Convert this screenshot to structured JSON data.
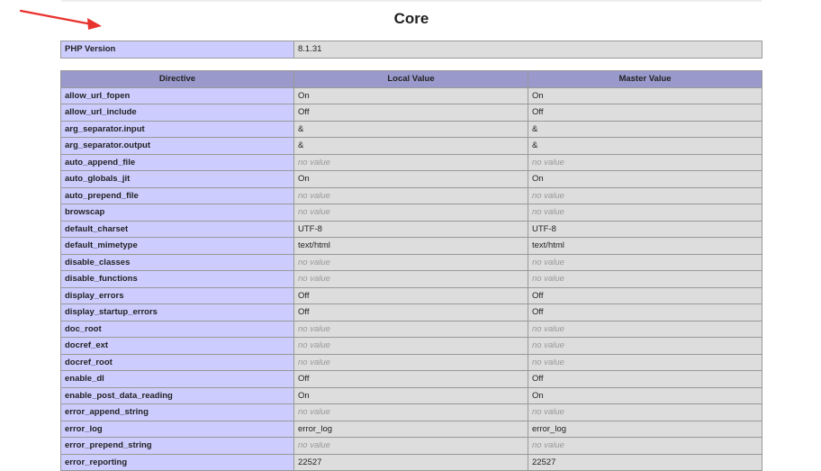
{
  "heading": "Core",
  "info_row": {
    "label": "PHP Version",
    "value": "8.1.31"
  },
  "headers": {
    "directive": "Directive",
    "local": "Local Value",
    "master": "Master Value"
  },
  "rows": [
    {
      "directive": "allow_url_fopen",
      "local": "On",
      "master": "On"
    },
    {
      "directive": "allow_url_include",
      "local": "Off",
      "master": "Off"
    },
    {
      "directive": "arg_separator.input",
      "local": "&",
      "master": "&"
    },
    {
      "directive": "arg_separator.output",
      "local": "&",
      "master": "&"
    },
    {
      "directive": "auto_append_file",
      "local": "no value",
      "master": "no value",
      "novalue": true
    },
    {
      "directive": "auto_globals_jit",
      "local": "On",
      "master": "On"
    },
    {
      "directive": "auto_prepend_file",
      "local": "no value",
      "master": "no value",
      "novalue": true
    },
    {
      "directive": "browscap",
      "local": "no value",
      "master": "no value",
      "novalue": true
    },
    {
      "directive": "default_charset",
      "local": "UTF-8",
      "master": "UTF-8"
    },
    {
      "directive": "default_mimetype",
      "local": "text/html",
      "master": "text/html"
    },
    {
      "directive": "disable_classes",
      "local": "no value",
      "master": "no value",
      "novalue": true
    },
    {
      "directive": "disable_functions",
      "local": "no value",
      "master": "no value",
      "novalue": true
    },
    {
      "directive": "display_errors",
      "local": "Off",
      "master": "Off"
    },
    {
      "directive": "display_startup_errors",
      "local": "Off",
      "master": "Off"
    },
    {
      "directive": "doc_root",
      "local": "no value",
      "master": "no value",
      "novalue": true
    },
    {
      "directive": "docref_ext",
      "local": "no value",
      "master": "no value",
      "novalue": true
    },
    {
      "directive": "docref_root",
      "local": "no value",
      "master": "no value",
      "novalue": true
    },
    {
      "directive": "enable_dl",
      "local": "Off",
      "master": "Off"
    },
    {
      "directive": "enable_post_data_reading",
      "local": "On",
      "master": "On"
    },
    {
      "directive": "error_append_string",
      "local": "no value",
      "master": "no value",
      "novalue": true
    },
    {
      "directive": "error_log",
      "local": "error_log",
      "master": "error_log"
    },
    {
      "directive": "error_prepend_string",
      "local": "no value",
      "master": "no value",
      "novalue": true
    },
    {
      "directive": "error_reporting",
      "local": "22527",
      "master": "22527"
    }
  ],
  "colors": {
    "header_bg": "#9999cc",
    "directive_bg": "#ccccff",
    "value_bg": "#dddddd",
    "novalue_text": "#999999",
    "arrow": "#e8322e"
  }
}
